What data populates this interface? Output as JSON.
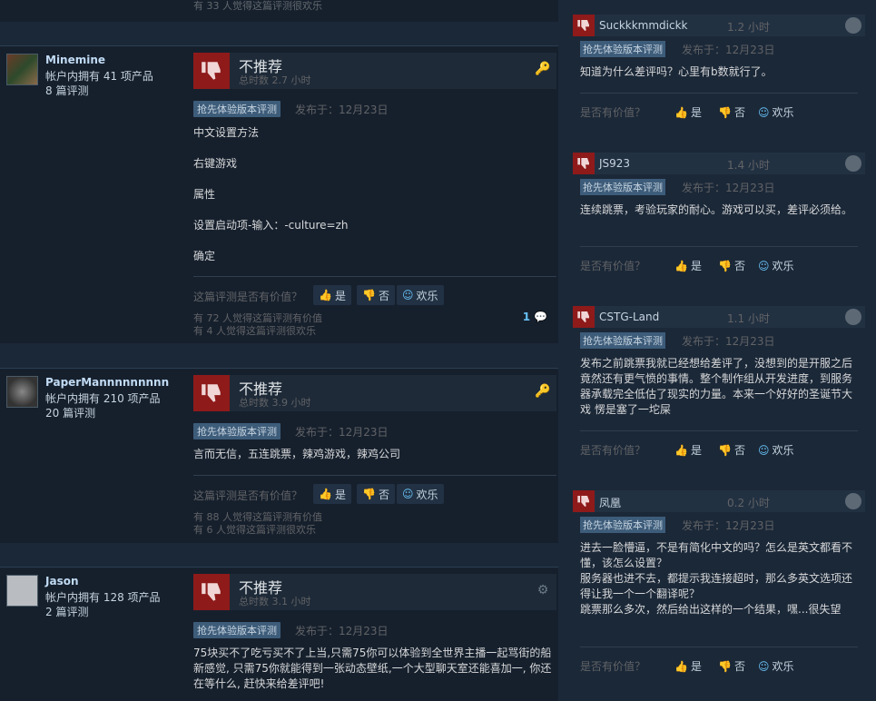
{
  "common": {
    "early_access_tag": "抢先体验版本评测",
    "posted_prefix": "发布于：",
    "helpful_question_left": "这篇评测是否有价值？",
    "helpful_question_right": "是否有价值？",
    "yes": "是",
    "no": "否",
    "funny": "欢乐"
  },
  "top_strip": {
    "funny_line": "有 33 人觉得这篇评测很欢乐"
  },
  "reviews": [
    {
      "user_name": "Minemine",
      "products_line": "帐户内拥有 41 项产品",
      "reviews_line": "8 篇评测",
      "verdict": "不推荐",
      "hours": "总时数 2.7 小时",
      "date": "12月23日",
      "paragraphs": [
        "中文设置方法",
        "右键游戏",
        "属性",
        "设置启动项-输入：-culture=zh",
        "确定"
      ],
      "helpful_line": "有 72 人觉得这篇评测有价值",
      "funny_line": "有 4 人觉得这篇评测很欢乐",
      "comments": "1"
    },
    {
      "user_name": "PaperMannnnnnnnn",
      "products_line": "帐户内拥有 210 项产品",
      "reviews_line": "20 篇评测",
      "verdict": "不推荐",
      "hours": "总时数 3.9 小时",
      "date": "12月23日",
      "paragraphs": [
        "言而无信，五连跳票，辣鸡游戏，辣鸡公司"
      ],
      "helpful_line": "有 88 人觉得这篇评测有价值",
      "funny_line": "有 6 人觉得这篇评测很欢乐"
    },
    {
      "user_name": "Jason",
      "products_line": "帐户内拥有 128 项产品",
      "reviews_line": "2 篇评测",
      "verdict": "不推荐",
      "hours": "总时数 3.1 小时",
      "date": "12月23日",
      "paragraphs": [
        "75块买不了吃亏买不了上当,只需75你可以体验到全世界主播一起骂街的船新感觉, 只需75你就能得到一张动态壁纸,一个大型聊天室还能喜加一, 你还在等什么, 赶快来给差评吧!"
      ]
    }
  ],
  "side_reviews": [
    {
      "name": "Suckkkmmdickk",
      "hours": "1.2 小时",
      "date": "12月23日",
      "text": "知道为什么差评吗？心里有b数就行了。"
    },
    {
      "name": "JS923",
      "hours": "1.4 小时",
      "date": "12月23日",
      "text": "连续跳票，考验玩家的耐心。游戏可以买，差评必须给。"
    },
    {
      "name": "CSTG-Land",
      "hours": "1.1 小时",
      "date": "12月23日",
      "text": "发布之前跳票我就已经想给差评了，没想到的是开服之后竟然还有更气愤的事情。整个制作组从开发进度，到服务器承载完全低估了现实的力量。本来一个好好的圣诞节大戏 愣是塞了一坨屎"
    },
    {
      "name": "凤凰",
      "hours": "0.2 小时",
      "date": "12月23日",
      "text": "进去一脸懵逼，不是有简化中文的吗？怎么是英文都看不懂，该怎么设置？\n服务器也进不去，都提示我连接超时，那么多英文选项还得让我一个一个翻译呢？\n跳票那么多次，然后给出这样的一个结果，嘿...很失望"
    }
  ]
}
